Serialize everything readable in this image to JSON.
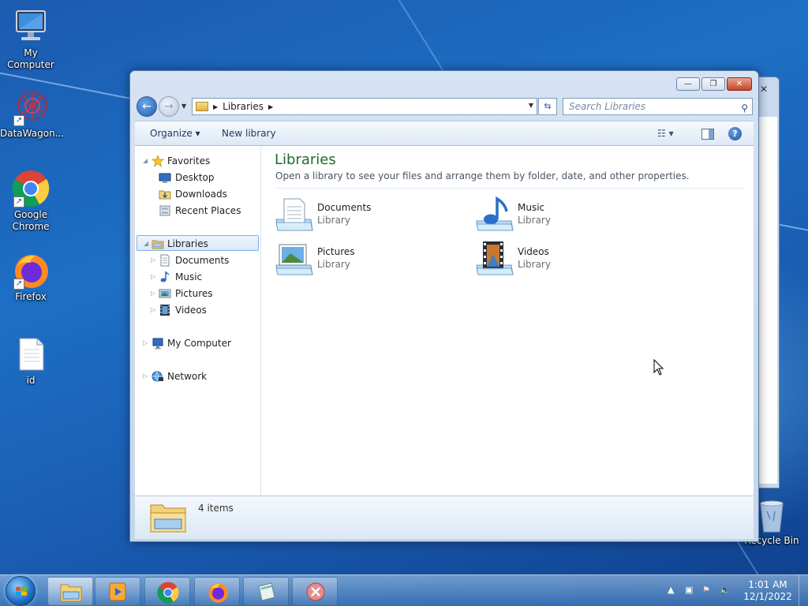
{
  "desktop": {
    "icons": [
      {
        "label": "My Computer"
      },
      {
        "label": "DataWagon..."
      },
      {
        "label": "Google Chrome"
      },
      {
        "label": "Firefox"
      },
      {
        "label": "id"
      },
      {
        "label": "Recycle Bin"
      }
    ]
  },
  "window": {
    "controls": {
      "minimize": "—",
      "maximize": "❐",
      "close": "✕"
    },
    "address": {
      "crumb": "Libraries"
    },
    "search": {
      "placeholder": "Search Libraries"
    },
    "toolbar": {
      "organize": "Organize ▾",
      "new_library": "New library",
      "views": "☷ ▾",
      "help": "?"
    },
    "nav": {
      "favorites": "Favorites",
      "desktop": "Desktop",
      "downloads": "Downloads",
      "recent": "Recent Places",
      "libraries": "Libraries",
      "documents": "Documents",
      "music": "Music",
      "pictures": "Pictures",
      "videos": "Videos",
      "computer": "My Computer",
      "network": "Network"
    },
    "content": {
      "title": "Libraries",
      "subtitle": "Open a library to see your files and arrange them by folder, date, and other properties.",
      "libraries": [
        {
          "name": "Documents",
          "type": "Library"
        },
        {
          "name": "Music",
          "type": "Library"
        },
        {
          "name": "Pictures",
          "type": "Library"
        },
        {
          "name": "Videos",
          "type": "Library"
        }
      ]
    },
    "details": {
      "count": "4 items"
    }
  },
  "taskbar": {
    "clock": {
      "time": "1:01 AM",
      "date": "12/1/2022"
    }
  }
}
